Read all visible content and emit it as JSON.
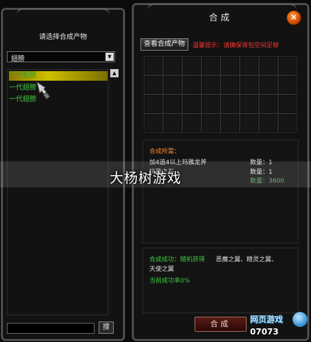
{
  "left": {
    "title": "请选择合成产物",
    "category": "翅膀",
    "items": [
      "一代翅膀",
      "一代翅膀",
      "一代翅膀"
    ],
    "search_button": "搜"
  },
  "right": {
    "title": "合成",
    "close_glyph": "×",
    "view_products_label": "查看合成产物",
    "tip_label": "温馨提示：",
    "tip_text": "请确保背包空间足够",
    "requirements_title": "合成所需：",
    "requirements": [
      {
        "name": "加4追4以上玛雅龙斧",
        "qty_label": "数量：1"
      },
      {
        "name": "玛雅之石",
        "qty_label": "数量：1"
      }
    ],
    "third_qty_label": "数量：3600",
    "success_label": "合成成功：随机获得",
    "success_items": "恶魔之翼、精灵之翼、",
    "success_items2": "天使之翼",
    "rate": "当前成功率0%",
    "craft_button": "合成"
  },
  "watermark": "大杨树游戏",
  "logo": {
    "line1": "网页游戏",
    "line2": "07073"
  }
}
